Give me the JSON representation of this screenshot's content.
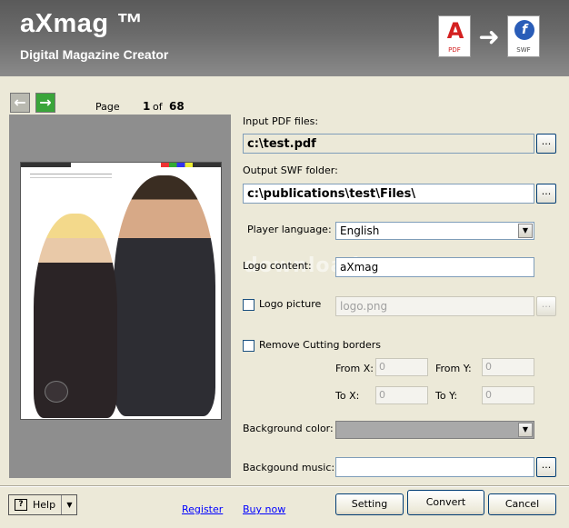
{
  "header": {
    "title": "aXmag ™",
    "subtitle": "Digital Magazine Creator",
    "pdf_icon_label": "PDF",
    "swf_icon_label": "SWF"
  },
  "navigation": {
    "prev_icon": "arrow-left-icon",
    "next_icon": "arrow-right-icon",
    "page_label": "Page",
    "current_page": "1",
    "of_label": "of",
    "total_pages": "68"
  },
  "form": {
    "input_pdf_label": "Input PDF files:",
    "input_pdf_value": "c:\\test.pdf",
    "output_swf_label": "Output SWF folder:",
    "output_swf_value": "c:\\publications\\test\\Files\\",
    "player_language_label": "Player language:",
    "player_language_value": "English",
    "logo_content_label": "Logo content:",
    "logo_content_value": "aXmag",
    "logo_picture_label": "Logo picture",
    "logo_picture_value": "logo.png",
    "remove_cutting_label": "Remove Cutting borders",
    "from_x_label": "From X:",
    "from_x_value": "0",
    "from_y_label": "From Y:",
    "from_y_value": "0",
    "to_x_label": "To X:",
    "to_x_value": "0",
    "to_y_label": "To Y:",
    "to_y_value": "0",
    "background_color_label": "Background color:",
    "background_music_label": "Backgound music:",
    "background_music_value": "",
    "browse_label": "..."
  },
  "footer": {
    "help_label": "Help",
    "register_link": "Register",
    "buynow_link": "Buy now",
    "setting_button": "Setting",
    "convert_button": "Convert",
    "cancel_button": "Cancel"
  },
  "watermark": "download"
}
